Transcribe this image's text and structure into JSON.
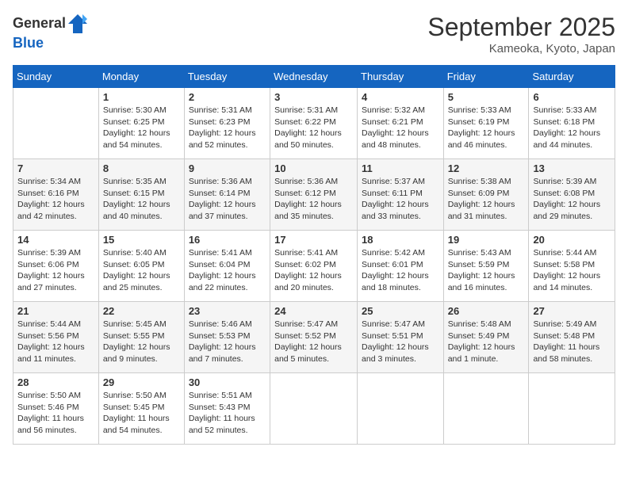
{
  "header": {
    "logo_line1": "General",
    "logo_line2": "Blue",
    "month": "September 2025",
    "location": "Kameoka, Kyoto, Japan"
  },
  "weekdays": [
    "Sunday",
    "Monday",
    "Tuesday",
    "Wednesday",
    "Thursday",
    "Friday",
    "Saturday"
  ],
  "weeks": [
    [
      {
        "day": "",
        "sunrise": "",
        "sunset": "",
        "daylight": ""
      },
      {
        "day": "1",
        "sunrise": "Sunrise: 5:30 AM",
        "sunset": "Sunset: 6:25 PM",
        "daylight": "Daylight: 12 hours and 54 minutes."
      },
      {
        "day": "2",
        "sunrise": "Sunrise: 5:31 AM",
        "sunset": "Sunset: 6:23 PM",
        "daylight": "Daylight: 12 hours and 52 minutes."
      },
      {
        "day": "3",
        "sunrise": "Sunrise: 5:31 AM",
        "sunset": "Sunset: 6:22 PM",
        "daylight": "Daylight: 12 hours and 50 minutes."
      },
      {
        "day": "4",
        "sunrise": "Sunrise: 5:32 AM",
        "sunset": "Sunset: 6:21 PM",
        "daylight": "Daylight: 12 hours and 48 minutes."
      },
      {
        "day": "5",
        "sunrise": "Sunrise: 5:33 AM",
        "sunset": "Sunset: 6:19 PM",
        "daylight": "Daylight: 12 hours and 46 minutes."
      },
      {
        "day": "6",
        "sunrise": "Sunrise: 5:33 AM",
        "sunset": "Sunset: 6:18 PM",
        "daylight": "Daylight: 12 hours and 44 minutes."
      }
    ],
    [
      {
        "day": "7",
        "sunrise": "Sunrise: 5:34 AM",
        "sunset": "Sunset: 6:16 PM",
        "daylight": "Daylight: 12 hours and 42 minutes."
      },
      {
        "day": "8",
        "sunrise": "Sunrise: 5:35 AM",
        "sunset": "Sunset: 6:15 PM",
        "daylight": "Daylight: 12 hours and 40 minutes."
      },
      {
        "day": "9",
        "sunrise": "Sunrise: 5:36 AM",
        "sunset": "Sunset: 6:14 PM",
        "daylight": "Daylight: 12 hours and 37 minutes."
      },
      {
        "day": "10",
        "sunrise": "Sunrise: 5:36 AM",
        "sunset": "Sunset: 6:12 PM",
        "daylight": "Daylight: 12 hours and 35 minutes."
      },
      {
        "day": "11",
        "sunrise": "Sunrise: 5:37 AM",
        "sunset": "Sunset: 6:11 PM",
        "daylight": "Daylight: 12 hours and 33 minutes."
      },
      {
        "day": "12",
        "sunrise": "Sunrise: 5:38 AM",
        "sunset": "Sunset: 6:09 PM",
        "daylight": "Daylight: 12 hours and 31 minutes."
      },
      {
        "day": "13",
        "sunrise": "Sunrise: 5:39 AM",
        "sunset": "Sunset: 6:08 PM",
        "daylight": "Daylight: 12 hours and 29 minutes."
      }
    ],
    [
      {
        "day": "14",
        "sunrise": "Sunrise: 5:39 AM",
        "sunset": "Sunset: 6:06 PM",
        "daylight": "Daylight: 12 hours and 27 minutes."
      },
      {
        "day": "15",
        "sunrise": "Sunrise: 5:40 AM",
        "sunset": "Sunset: 6:05 PM",
        "daylight": "Daylight: 12 hours and 25 minutes."
      },
      {
        "day": "16",
        "sunrise": "Sunrise: 5:41 AM",
        "sunset": "Sunset: 6:04 PM",
        "daylight": "Daylight: 12 hours and 22 minutes."
      },
      {
        "day": "17",
        "sunrise": "Sunrise: 5:41 AM",
        "sunset": "Sunset: 6:02 PM",
        "daylight": "Daylight: 12 hours and 20 minutes."
      },
      {
        "day": "18",
        "sunrise": "Sunrise: 5:42 AM",
        "sunset": "Sunset: 6:01 PM",
        "daylight": "Daylight: 12 hours and 18 minutes."
      },
      {
        "day": "19",
        "sunrise": "Sunrise: 5:43 AM",
        "sunset": "Sunset: 5:59 PM",
        "daylight": "Daylight: 12 hours and 16 minutes."
      },
      {
        "day": "20",
        "sunrise": "Sunrise: 5:44 AM",
        "sunset": "Sunset: 5:58 PM",
        "daylight": "Daylight: 12 hours and 14 minutes."
      }
    ],
    [
      {
        "day": "21",
        "sunrise": "Sunrise: 5:44 AM",
        "sunset": "Sunset: 5:56 PM",
        "daylight": "Daylight: 12 hours and 11 minutes."
      },
      {
        "day": "22",
        "sunrise": "Sunrise: 5:45 AM",
        "sunset": "Sunset: 5:55 PM",
        "daylight": "Daylight: 12 hours and 9 minutes."
      },
      {
        "day": "23",
        "sunrise": "Sunrise: 5:46 AM",
        "sunset": "Sunset: 5:53 PM",
        "daylight": "Daylight: 12 hours and 7 minutes."
      },
      {
        "day": "24",
        "sunrise": "Sunrise: 5:47 AM",
        "sunset": "Sunset: 5:52 PM",
        "daylight": "Daylight: 12 hours and 5 minutes."
      },
      {
        "day": "25",
        "sunrise": "Sunrise: 5:47 AM",
        "sunset": "Sunset: 5:51 PM",
        "daylight": "Daylight: 12 hours and 3 minutes."
      },
      {
        "day": "26",
        "sunrise": "Sunrise: 5:48 AM",
        "sunset": "Sunset: 5:49 PM",
        "daylight": "Daylight: 12 hours and 1 minute."
      },
      {
        "day": "27",
        "sunrise": "Sunrise: 5:49 AM",
        "sunset": "Sunset: 5:48 PM",
        "daylight": "Daylight: 11 hours and 58 minutes."
      }
    ],
    [
      {
        "day": "28",
        "sunrise": "Sunrise: 5:50 AM",
        "sunset": "Sunset: 5:46 PM",
        "daylight": "Daylight: 11 hours and 56 minutes."
      },
      {
        "day": "29",
        "sunrise": "Sunrise: 5:50 AM",
        "sunset": "Sunset: 5:45 PM",
        "daylight": "Daylight: 11 hours and 54 minutes."
      },
      {
        "day": "30",
        "sunrise": "Sunrise: 5:51 AM",
        "sunset": "Sunset: 5:43 PM",
        "daylight": "Daylight: 11 hours and 52 minutes."
      },
      {
        "day": "",
        "sunrise": "",
        "sunset": "",
        "daylight": ""
      },
      {
        "day": "",
        "sunrise": "",
        "sunset": "",
        "daylight": ""
      },
      {
        "day": "",
        "sunrise": "",
        "sunset": "",
        "daylight": ""
      },
      {
        "day": "",
        "sunrise": "",
        "sunset": "",
        "daylight": ""
      }
    ]
  ]
}
